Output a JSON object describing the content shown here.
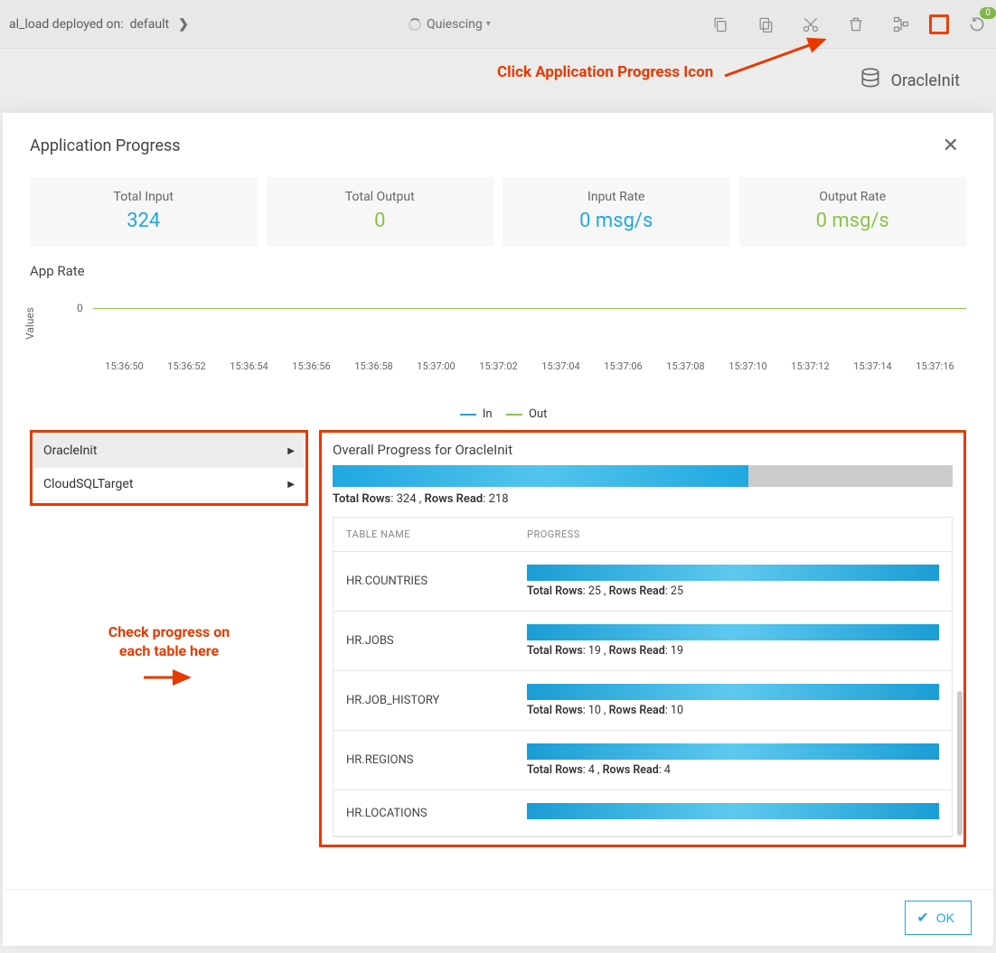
{
  "topbar": {
    "deploy_prefix": "al_load",
    "deploy_label": "deployed on:",
    "deploy_target": "default",
    "status": "Quiescing",
    "badge": "0",
    "node_name": "OracleInit"
  },
  "annotations": {
    "click_icon": "Click Application Progress Icon",
    "check_progress_l1": "Check progress on",
    "check_progress_l2": "each table here"
  },
  "modal": {
    "title": "Application Progress",
    "ok": "OK"
  },
  "stats": {
    "total_input_label": "Total Input",
    "total_input_value": "324",
    "total_output_label": "Total Output",
    "total_output_value": "0",
    "input_rate_label": "Input Rate",
    "input_rate_value": "0 msg/s",
    "output_rate_label": "Output Rate",
    "output_rate_value": "0 msg/s"
  },
  "chart": {
    "title": "App Rate",
    "y_label": "Values",
    "zero": "0",
    "legend_in": "In",
    "legend_out": "Out",
    "ticks": [
      "15:36:50",
      "15:36:52",
      "15:36:54",
      "15:36:56",
      "15:36:58",
      "15:37:00",
      "15:37:02",
      "15:37:04",
      "15:37:06",
      "15:37:08",
      "15:37:10",
      "15:37:12",
      "15:37:14",
      "15:37:16"
    ]
  },
  "chart_data": {
    "type": "line",
    "title": "App Rate",
    "xlabel": "",
    "ylabel": "Values",
    "ylim": [
      0,
      1
    ],
    "categories": [
      "15:36:50",
      "15:36:52",
      "15:36:54",
      "15:36:56",
      "15:36:58",
      "15:37:00",
      "15:37:02",
      "15:37:04",
      "15:37:06",
      "15:37:08",
      "15:37:10",
      "15:37:12",
      "15:37:14",
      "15:37:16"
    ],
    "series": [
      {
        "name": "In",
        "values": [
          0,
          0,
          0,
          0,
          0,
          0,
          0,
          0,
          0,
          0,
          0,
          0,
          0,
          0
        ]
      },
      {
        "name": "Out",
        "values": [
          0,
          0,
          0,
          0,
          0,
          0,
          0,
          0,
          0,
          0,
          0,
          0,
          0,
          0
        ]
      }
    ]
  },
  "sources": [
    {
      "name": "OracleInit",
      "active": true
    },
    {
      "name": "CloudSQLTarget",
      "active": false
    }
  ],
  "detail": {
    "title": "Overall Progress for OracleInit",
    "total_rows_label": "Total Rows",
    "total_rows_value": "324",
    "rows_read_label": "Rows Read",
    "rows_read_value": "218",
    "overall_percent": 67,
    "th_table": "TABLE NAME",
    "th_progress": "PROGRESS",
    "tables": [
      {
        "name": "HR.COUNTRIES",
        "total": "25",
        "read": "25",
        "pct": 100
      },
      {
        "name": "HR.JOBS",
        "total": "19",
        "read": "19",
        "pct": 100
      },
      {
        "name": "HR.JOB_HISTORY",
        "total": "10",
        "read": "10",
        "pct": 100
      },
      {
        "name": "HR.REGIONS",
        "total": "4",
        "read": "4",
        "pct": 100
      },
      {
        "name": "HR.LOCATIONS",
        "total": "",
        "read": "",
        "pct": 100
      }
    ]
  }
}
